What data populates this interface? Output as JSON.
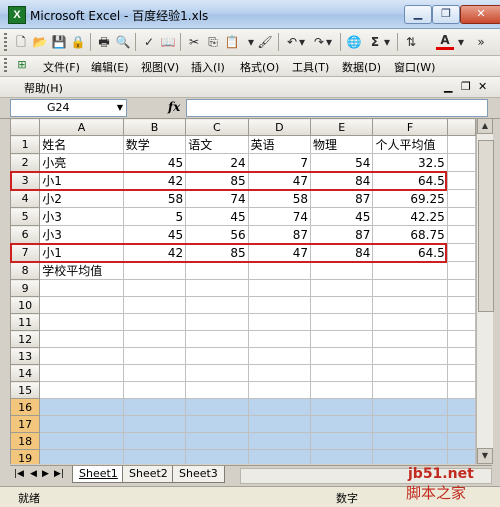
{
  "window": {
    "title": "Microsoft Excel - 百度经验1.xls",
    "app_icon": "excel-icon"
  },
  "toolbar": {
    "icons": [
      "new-icon",
      "open-icon",
      "save-icon",
      "permission-icon",
      "print-icon",
      "print-preview-icon",
      "spelling-icon",
      "research-icon",
      "cut-icon",
      "copy-icon",
      "paste-icon",
      "format-painter-icon",
      "undo-icon",
      "redo-icon",
      "hyperlink-icon",
      "autosum-icon",
      "sort-icon",
      "font-color-icon"
    ],
    "autosum_label": "Σ",
    "font_color_label": "A",
    "font_color": "#e00000"
  },
  "menu": {
    "items": [
      "文件(F)",
      "编辑(E)",
      "视图(V)",
      "插入(I)",
      "格式(O)",
      "工具(T)",
      "数据(D)",
      "窗口(W)"
    ],
    "help": "帮助(H)"
  },
  "formula": {
    "namebox": "G24",
    "fx": "fx"
  },
  "grid": {
    "columns": [
      "A",
      "B",
      "C",
      "D",
      "E",
      "F"
    ],
    "rows": [
      {
        "n": "1",
        "cells": [
          "姓名",
          "数学",
          "语文",
          "英语",
          "物理",
          "个人平均值"
        ]
      },
      {
        "n": "2",
        "cells": [
          "小亮",
          "45",
          "24",
          "7",
          "54",
          "32.5"
        ]
      },
      {
        "n": "3",
        "cells": [
          "小1",
          "42",
          "85",
          "47",
          "84",
          "64.5"
        ]
      },
      {
        "n": "4",
        "cells": [
          "小2",
          "58",
          "74",
          "58",
          "87",
          "69.25"
        ]
      },
      {
        "n": "5",
        "cells": [
          "小3",
          "5",
          "45",
          "74",
          "45",
          "42.25"
        ]
      },
      {
        "n": "6",
        "cells": [
          "小3",
          "45",
          "56",
          "87",
          "87",
          "68.75"
        ]
      },
      {
        "n": "7",
        "cells": [
          "小1",
          "42",
          "85",
          "47",
          "84",
          "64.5"
        ]
      },
      {
        "n": "8",
        "cells": [
          "学校平均值",
          "",
          "",
          "",
          "",
          ""
        ]
      },
      {
        "n": "9",
        "cells": [
          "",
          "",
          "",
          "",
          "",
          ""
        ]
      },
      {
        "n": "10",
        "cells": [
          "",
          "",
          "",
          "",
          "",
          ""
        ]
      },
      {
        "n": "11",
        "cells": [
          "",
          "",
          "",
          "",
          "",
          ""
        ]
      },
      {
        "n": "12",
        "cells": [
          "",
          "",
          "",
          "",
          "",
          ""
        ]
      },
      {
        "n": "13",
        "cells": [
          "",
          "",
          "",
          "",
          "",
          ""
        ]
      },
      {
        "n": "14",
        "cells": [
          "",
          "",
          "",
          "",
          "",
          ""
        ]
      },
      {
        "n": "15",
        "cells": [
          "",
          "",
          "",
          "",
          "",
          ""
        ]
      },
      {
        "n": "16",
        "cells": [
          "",
          "",
          "",
          "",
          "",
          ""
        ]
      },
      {
        "n": "17",
        "cells": [
          "",
          "",
          "",
          "",
          "",
          ""
        ]
      },
      {
        "n": "18",
        "cells": [
          "",
          "",
          "",
          "",
          "",
          ""
        ]
      },
      {
        "n": "19",
        "cells": [
          "",
          "",
          "",
          "",
          "",
          ""
        ]
      }
    ],
    "selected_rows": [
      "16",
      "17",
      "18",
      "19"
    ],
    "highlighted_rows": [
      "3",
      "7"
    ],
    "highlight_color": "#cc1f1f",
    "selection_color": "#bbd4ee"
  },
  "sheets": [
    "Sheet1",
    "Sheet2",
    "Sheet3"
  ],
  "status": {
    "ready": "就绪",
    "num": "数字"
  },
  "watermark": {
    "logo": "jb51.net",
    "text": "脚本之家"
  }
}
